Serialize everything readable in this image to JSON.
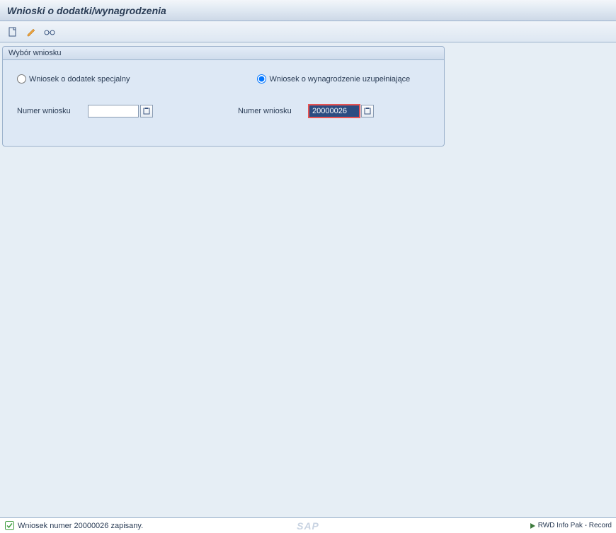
{
  "title": "Wnioski o dodatki/wynagrodzenia",
  "toolbar": {
    "icons": [
      "document-icon",
      "pencil-icon",
      "glasses-icon"
    ]
  },
  "group": {
    "title": "Wybór wniosku",
    "radio1": {
      "label": "Wniosek o dodatek specjalny",
      "checked": false
    },
    "radio2": {
      "label": "Wniosek o wynagrodzenie uzupełniające",
      "checked": true
    },
    "field1": {
      "label": "Numer wniosku",
      "value": ""
    },
    "field2": {
      "label": "Numer wniosku",
      "value": "20000026"
    }
  },
  "statusbar": {
    "message": "Wniosek numer 20000026 zapisany.",
    "right": "RWD Info Pak - Record"
  }
}
